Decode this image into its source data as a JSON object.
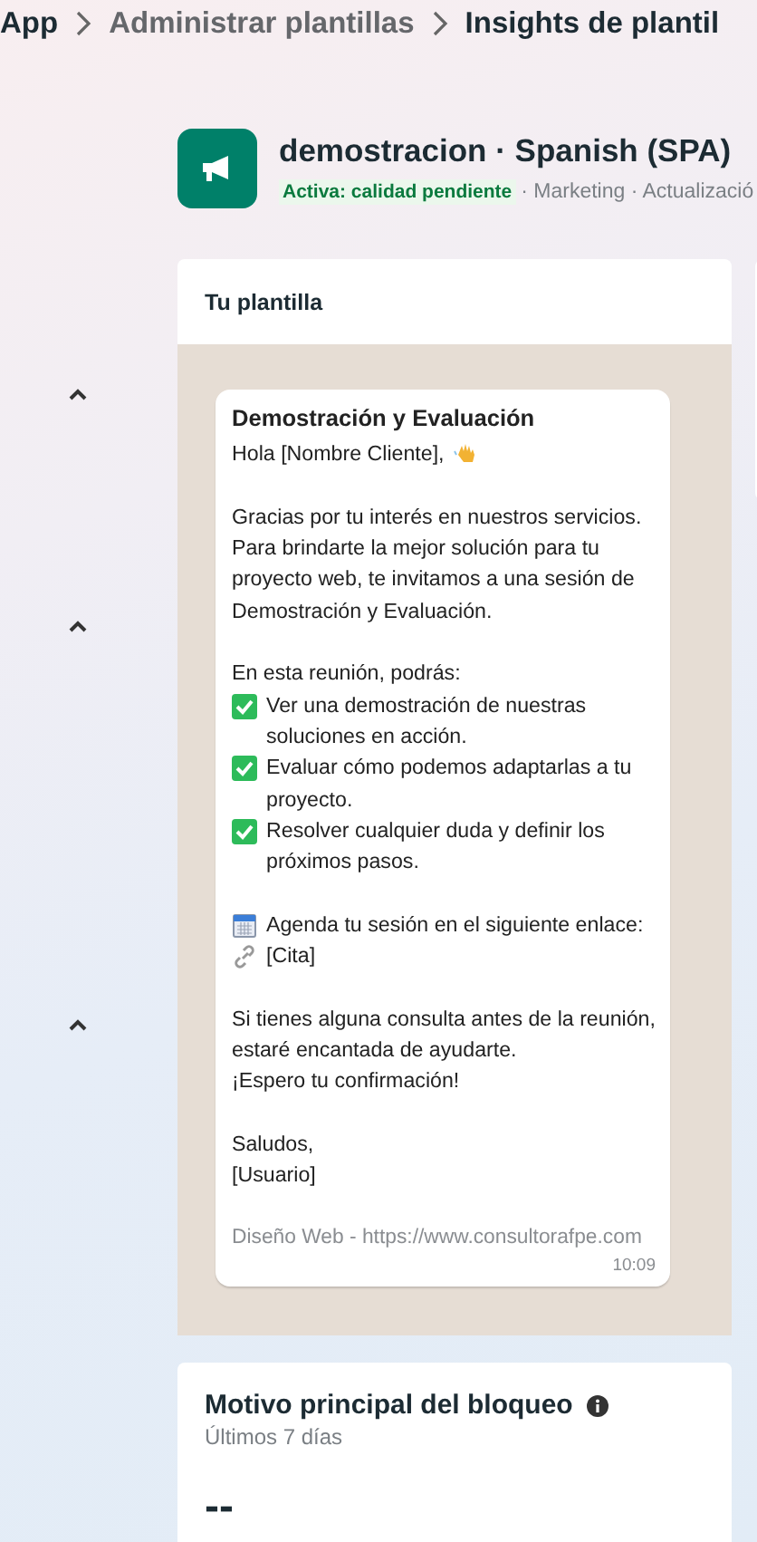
{
  "breadcrumb": [
    {
      "label": "App",
      "current": false
    },
    {
      "label": "Administrar plantillas",
      "current": false
    },
    {
      "label": "Insights de plantil",
      "current": true
    }
  ],
  "template_header": {
    "title": "demostracion · Spanish (SPA)",
    "status": "Activa: calidad pendiente",
    "meta": "· Marketing · Actualizació"
  },
  "section_toggles": [
    {
      "expanded": true
    },
    {
      "expanded": true
    },
    {
      "expanded": true
    }
  ],
  "preview_card": {
    "title": "Tu plantilla",
    "message": {
      "header": "Demostración y Evaluación",
      "blocks": [
        {
          "lines": [
            {
              "text": "Hola [Nombre Cliente],",
              "kind": "wave"
            }
          ]
        },
        {
          "lines": [
            {
              "text": "Gracias por tu interés en nuestros servicios. Para brindarte la mejor solución para tu proyecto web, te invitamos a una sesión de Demostración y Evaluación."
            }
          ]
        },
        {
          "lines": [
            {
              "text": "En esta reunión, podrás:"
            },
            {
              "text": "Ver una demostración de nuestras soluciones en acción.",
              "kind": "check"
            },
            {
              "text": "Evaluar cómo podemos adaptarlas a tu proyecto.",
              "kind": "check"
            },
            {
              "text": "Resolver cualquier duda y definir los próximos pasos.",
              "kind": "check"
            }
          ]
        },
        {
          "lines": [
            {
              "text": "Agenda tu sesión en el siguiente enlace:",
              "kind": "calendar"
            },
            {
              "text": "[Cita]",
              "kind": "link"
            }
          ]
        },
        {
          "lines": [
            {
              "text": "Si tienes alguna consulta antes de la reunión, estaré encantada de ayudarte."
            },
            {
              "text": "¡Espero tu confirmación!"
            }
          ]
        },
        {
          "lines": [
            {
              "text": "Saludos,"
            },
            {
              "text": "[Usuario]"
            }
          ]
        }
      ],
      "footer": "Diseño Web - https://www.consultorafpe.com",
      "time": "10:09"
    }
  },
  "block_reason_card": {
    "title": "Motivo principal del bloqueo",
    "period": "Últimos 7 días",
    "value": "--"
  }
}
